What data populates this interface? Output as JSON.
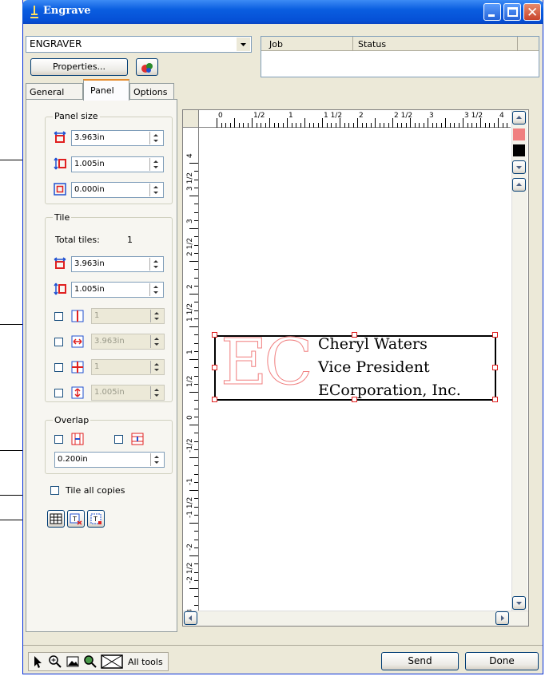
{
  "window": {
    "title": "Engrave"
  },
  "device": {
    "selected": "ENGRAVER",
    "properties_label": "Properties..."
  },
  "jobs": {
    "columns": [
      "Job",
      "Status"
    ]
  },
  "tabs": [
    "General",
    "Panel",
    "Options"
  ],
  "panel_size": {
    "label": "Panel size",
    "width": "3.963in",
    "height": "1.005in",
    "margin": "0.000in"
  },
  "tile": {
    "label": "Tile",
    "total_label": "Total tiles:",
    "total_value": "1",
    "width": "3.963in",
    "height": "1.005in",
    "col_count": "1",
    "col_size": "3.963in",
    "row_count": "1",
    "row_size": "1.005in"
  },
  "overlap": {
    "label": "Overlap",
    "value": "0.200in"
  },
  "tile_all_copies": "Tile all copies",
  "ruler": {
    "top": [
      "0",
      "1/2",
      "1",
      "1 1/2",
      "2",
      "2 1/2",
      "3",
      "3 1/2",
      "4"
    ],
    "left": [
      "4",
      "3 1/2",
      "3",
      "2 1/2",
      "2",
      "1 1/2",
      "1",
      "1/2",
      "0",
      "-1/2",
      "-1",
      "-1 1/2",
      "-2",
      "-2 1/2",
      "-3"
    ]
  },
  "canvas": {
    "logo": "EC",
    "lines": [
      "Cheryl Waters",
      "Vice President",
      "ECorporation, Inc."
    ]
  },
  "swatches": {
    "colors": [
      "#f08080",
      "#000000"
    ]
  },
  "statusbar": {
    "tools_label": "All tools"
  },
  "footer": {
    "send_label": "Send",
    "done_label": "Done"
  },
  "colors": {
    "titlebar": "#0a5ee0",
    "window_bg": "#ece9d8",
    "accent_red": "#e02020",
    "accent_blue": "#2050d0"
  }
}
